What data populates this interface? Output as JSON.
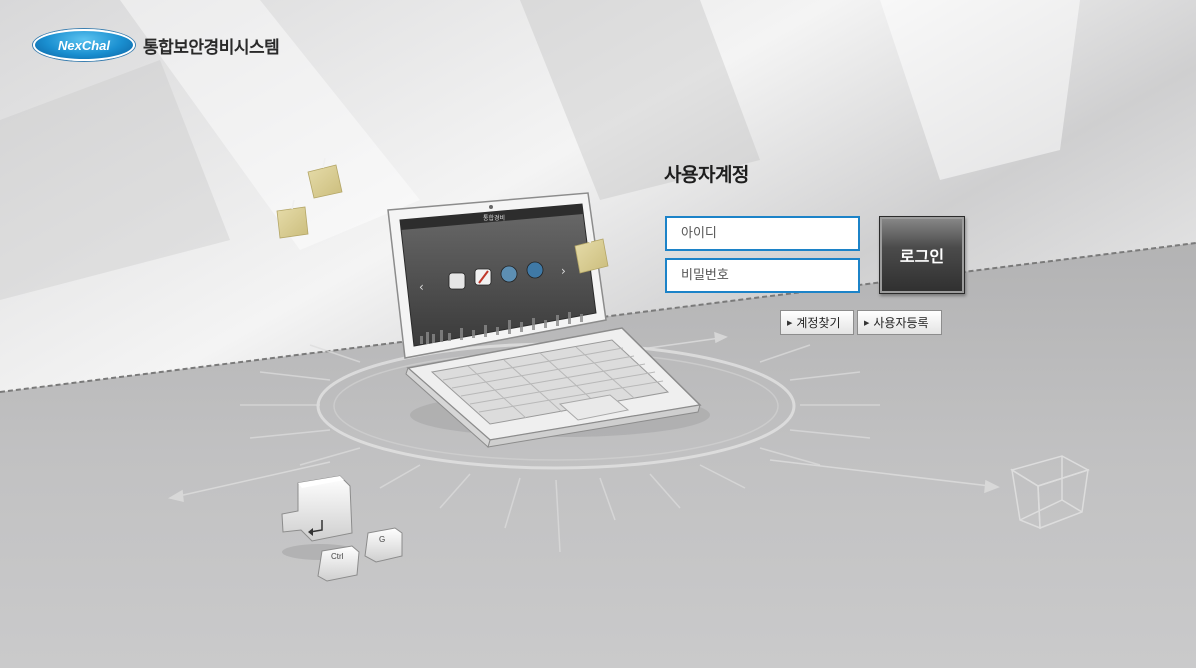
{
  "brand": {
    "logo_text": "NexChal",
    "system_title": "통합보안경비시스템"
  },
  "login": {
    "heading": "사용자계정",
    "id_placeholder": "아이디",
    "password_placeholder": "비밀번호",
    "login_button": "로그인",
    "find_account_button": "계정찾기",
    "register_button": "사용자등록"
  },
  "illustration": {
    "laptop_screen_title": "통합경비",
    "ctrl_key": "Ctrl",
    "g_key": "G"
  },
  "icons": [
    "arrow-right-icon",
    "enter-key-icon",
    "sticky-note-icon"
  ],
  "colors": {
    "field_border": "#1c83c8",
    "logo_blue": "#1a8fd0",
    "login_button_dark": "#3a3a3a"
  }
}
